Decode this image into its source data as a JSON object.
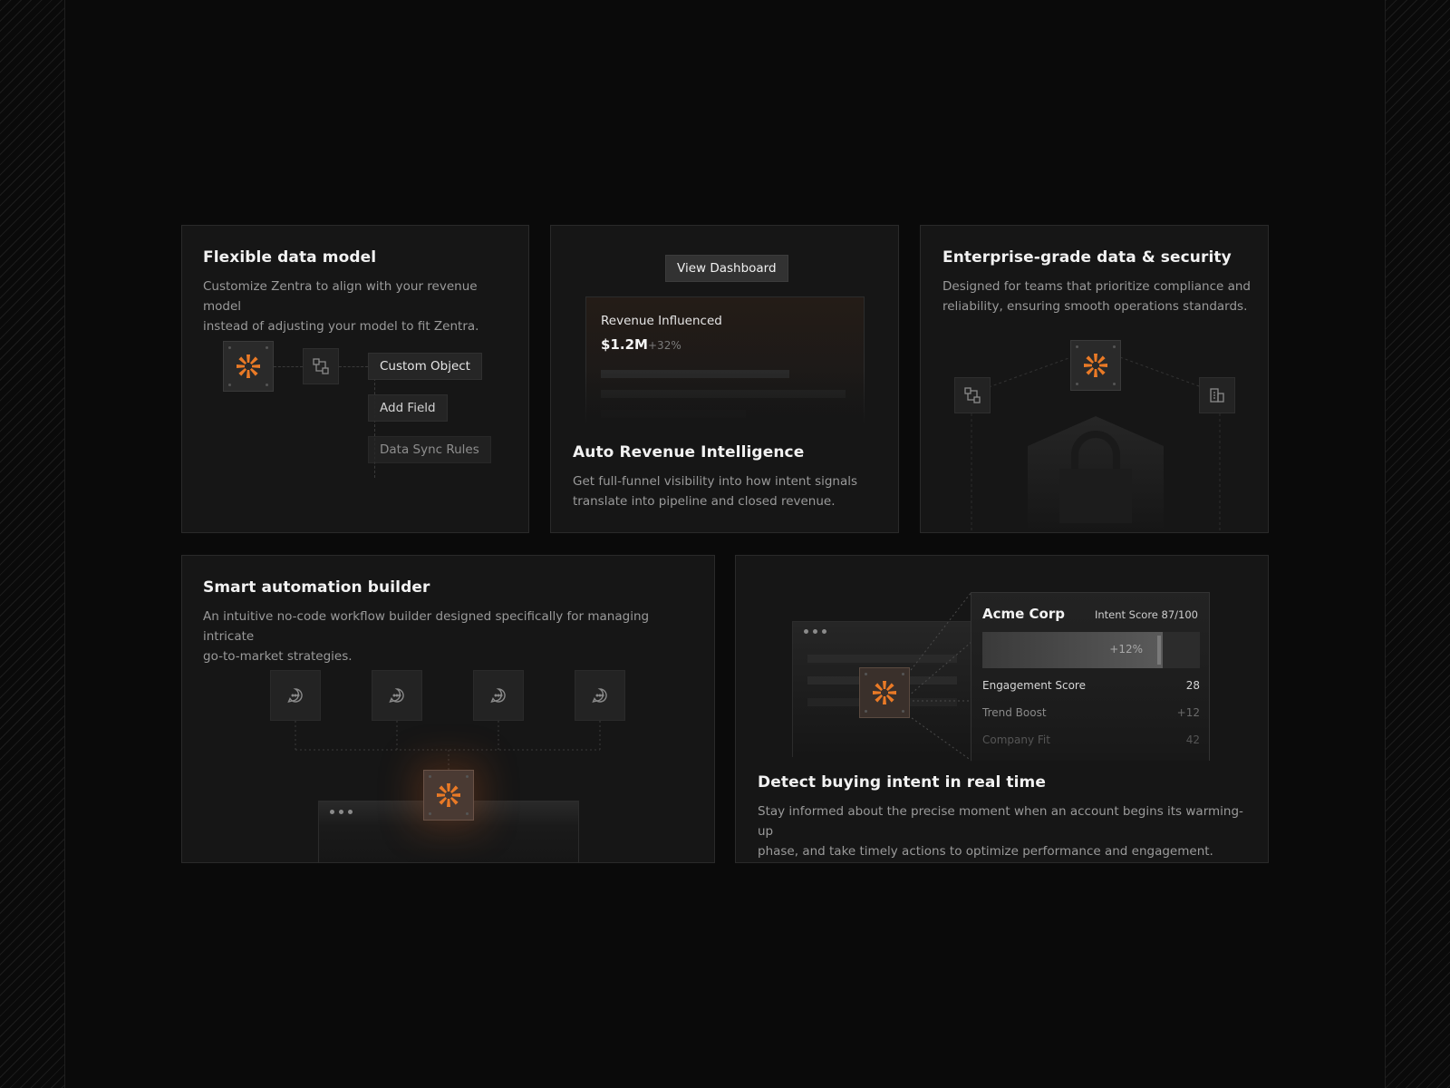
{
  "cards": {
    "flexible": {
      "title": "Flexible data model",
      "desc_line1": "Customize Zentra to align with your revenue model",
      "desc_line2": "instead of adjusting your model to fit Zentra.",
      "chips": [
        "Custom Object",
        "Add Field",
        "Data Sync Rules"
      ]
    },
    "revenue": {
      "button_label": "View Dashboard",
      "metric_label": "Revenue Influenced",
      "metric_value": "$1.2M",
      "metric_change": "+32%",
      "title": "Auto Revenue Intelligence",
      "desc_line1": "Get full-funnel visibility into how intent signals",
      "desc_line2": "translate into pipeline and closed revenue."
    },
    "security": {
      "title": "Enterprise-grade data & security",
      "desc_line1": "Designed for teams that prioritize compliance and",
      "desc_line2": "reliability, ensuring smooth operations standards."
    },
    "automation": {
      "title": "Smart automation builder",
      "desc_line1": "An intuitive no-code workflow builder designed specifically for managing intricate",
      "desc_line2": "go-to-market strategies."
    },
    "intent": {
      "company": "Acme Corp",
      "intent_score_label": "Intent Score 87/100",
      "intent_fill": 0.83,
      "bar_change": "+12%",
      "rows": [
        {
          "label": "Engagement Score",
          "value": "28"
        },
        {
          "label": "Trend Boost",
          "value": "+12"
        },
        {
          "label": "Company Fit",
          "value": "42"
        }
      ],
      "title": "Detect buying intent in real time",
      "desc_line1": "Stay informed about the precise moment when an account begins its warming-up",
      "desc_line2": "phase, and take timely actions to optimize performance and engagement."
    }
  },
  "colors": {
    "accent": "#ea7a26",
    "background": "#0a0a0a",
    "card": "#161616"
  },
  "icons": {
    "logo": "zentra-sunburst-icon",
    "object": "object-icon",
    "building": "building-icon",
    "lock": "lock-icon",
    "message": "message-dots-icon"
  }
}
